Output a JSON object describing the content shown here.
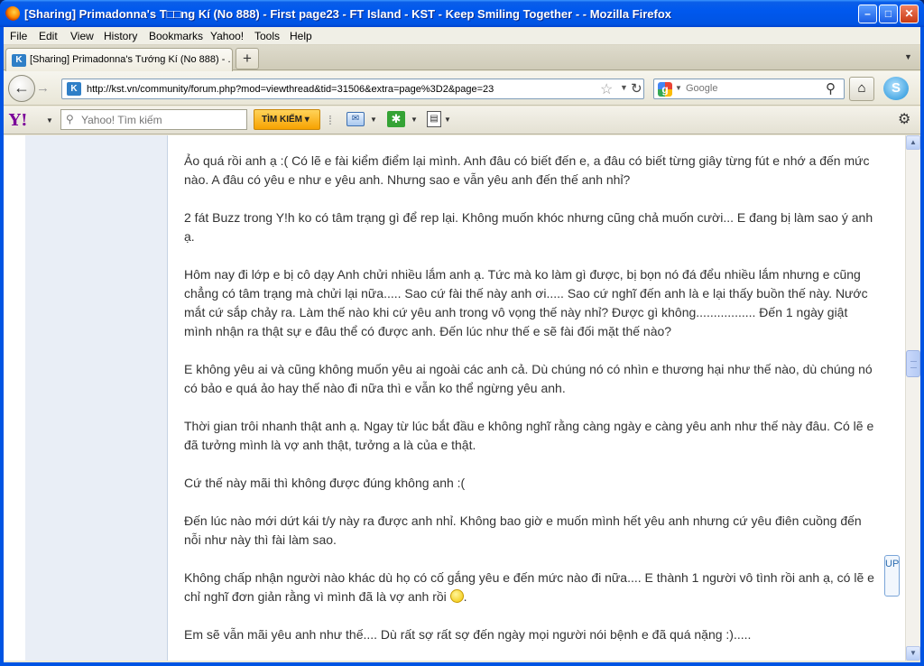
{
  "window": {
    "title": "[Sharing] Primadonna's T□□ng Kí (No 888) - First page23 - FT Island - KST - Keep Smiling Together - - Mozilla Firefox",
    "min_label": "–",
    "max_label": "□",
    "close_label": "✕"
  },
  "menu": [
    "File",
    "Edit",
    "View",
    "History",
    "Bookmarks",
    "Yahoo!",
    "Tools",
    "Help"
  ],
  "tab": {
    "label": "[Sharing] Primadonna's Tướng Kí (No 888) - ...",
    "new_tab": "+"
  },
  "nav": {
    "url": "http://kst.vn/community/forum.php?mod=viewthread&tid=31506&extra=page%3D2&page=23",
    "search_placeholder": "Google"
  },
  "yahoo": {
    "logo": "Y!",
    "search_placeholder": "Yahoo! Tìm kiếm",
    "search_button": "TÌM KIẾM"
  },
  "post": {
    "paragraphs": [
      "Ảo quá rồi anh ạ :( Có lẽ e fài kiểm điểm lại mình. Anh đâu có biết đến e, a đâu có biết từng giây từng fút e nhớ a đến mức nào. A đâu có yêu e như e yêu anh. Nhưng sao e vẫn yêu anh đến thế anh nhỉ?",
      "2 fát Buzz trong Y!h ko có tâm trạng gì để rep lại. Không muốn khóc nhưng cũng chả muốn cười... E đang bị làm sao ý anh ạ.",
      "Hôm nay đi lớp e bị cô dạy Anh chửi nhiều lắm anh ạ. Tức mà ko làm gì được, bị bọn nó đá đểu nhiều lắm nhưng e cũng chẳng có tâm trạng mà chửi lại nữa..... Sao cứ fài thế này anh ơi..... Sao cứ nghĩ đến anh là e lại thấy buồn thế này.  Nước mắt cứ sắp chảy ra. Làm thế nào khi cứ yêu anh trong vô vọng thế này nhỉ? Được gì không................. Đến 1 ngày giật mình nhận ra thật sự e đâu thể có được anh. Đến lúc như thế e sẽ fài đối mặt thế nào?",
      "E không yêu ai và cũng không muốn yêu ai ngoài các anh cả. Dù chúng nó có nhìn e thương hại như thế nào, dù chúng nó có bảo e quá ảo hay thế nào đi nữa thì e vẫn ko thể ngừng yêu anh.",
      "Thời gian trôi nhanh thật anh ạ. Ngay từ lúc bắt đầu e không nghĩ rằng càng ngày e càng yêu anh như thế này đâu. Có lẽ e đã tưởng mình là vợ anh thật, tưởng a là của e thật.",
      "Cứ thế này mãi thì không được đúng không anh :(",
      "Đến lúc nào mới dứt kái t/y này ra được anh nhỉ. Không bao giờ e muốn mình hết yêu anh nhưng cứ yêu điên cuồng đến nỗi như này thì fài làm sao.",
      "Không chấp nhận người nào khác dù họ có cố gắng yêu e đến mức nào đi nữa.... E thành 1 người vô tình rồi anh ạ, có lẽ e chỉ nghĩ đơn giản rằng vì mình đã là vợ anh rồi",
      "Em sẽ vẫn mãi yêu anh như thế.... Dù rất sợ rất sợ đến ngày mọi người nói bệnh e đã quá nặng :)....."
    ],
    "after_smiley": "."
  },
  "float_up_label": "UP",
  "colors": {
    "titlebar": "#0054e3",
    "content_bg": "#ffffff",
    "sidebar_bg": "#e9eef6",
    "text": "#333333"
  }
}
